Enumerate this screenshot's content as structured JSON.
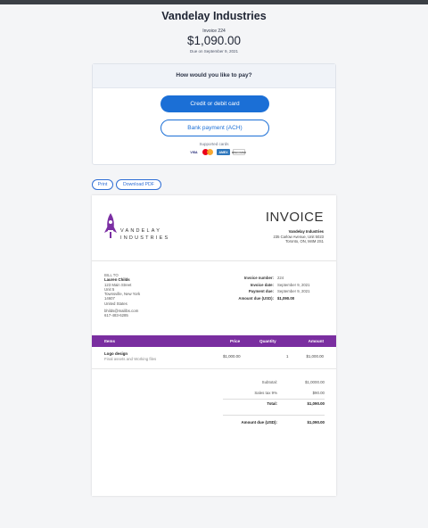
{
  "header": {
    "company": "Vandelay Industries",
    "invoice_label": "Invoice 224",
    "amount": "$1,090.00",
    "due": "Due on September 9, 2021"
  },
  "pay": {
    "question": "How would you like to pay?",
    "card_button": "Credit or debit card",
    "ach_button": "Bank payment (ACH)",
    "supported_label": "Supported cards",
    "cards": [
      "VISA",
      "Mastercard",
      "AMEX",
      "DISCOVER"
    ]
  },
  "actions": {
    "print": "Print",
    "pdf": "Download PDF"
  },
  "doc": {
    "logo_line1": "VANDELAY",
    "logo_line2": "INDUSTRIES",
    "title": "INVOICE",
    "from_name": "Vandelay Industries",
    "from_addr1": "235 Carlow Avenue, Unit 5023",
    "from_addr2": "Toronto, ON, M4M 2S1",
    "bill_to": "BILL TO",
    "bill_name": "Lauren Childs",
    "bill_lines": [
      "123 Main Street",
      "Unit 5",
      "Townsville, New York",
      "14607",
      "United States"
    ],
    "bill_email": "bhilds@mailibs.com",
    "bill_phone": "617-483-6285",
    "meta": [
      {
        "k": "Invoice number:",
        "v": "224"
      },
      {
        "k": "Invoice date:",
        "v": "September 9, 2021"
      },
      {
        "k": "Payment due:",
        "v": "September 9, 2021"
      },
      {
        "k": "Amount due (USD):",
        "v": "$1,090.00"
      }
    ],
    "cols": {
      "items": "Items",
      "price": "Price",
      "qty": "Quantity",
      "amount": "Amount"
    },
    "line": {
      "name": "Logo design",
      "desc": "Final assets and Working files",
      "price": "$1,000.00",
      "qty": "1",
      "amount": "$1,000.00"
    },
    "subtotal_k": "Subtotal:",
    "subtotal_v": "$1,0000.00",
    "tax_k": "Sales tax 9%",
    "tax_v": "$90.00",
    "total_k": "Total:",
    "total_v": "$1,090.00",
    "due_k": "Amount due (USD):",
    "due_v": "$1,090.00"
  },
  "colors": {
    "primary": "#1b6fd6",
    "table_header": "#7a2ea0",
    "logo": "#7b2fa3"
  }
}
